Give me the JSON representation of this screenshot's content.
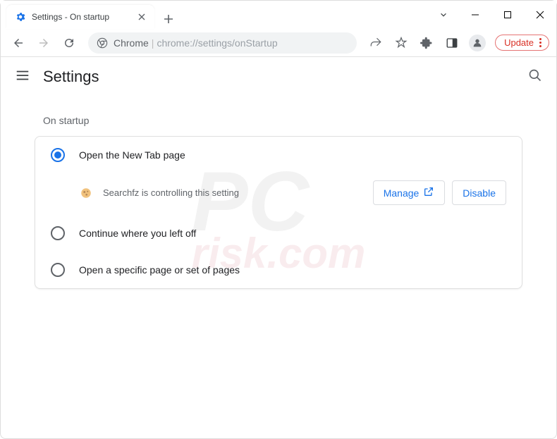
{
  "window": {
    "tab_title": "Settings - On startup"
  },
  "toolbar": {
    "omnibox_origin": "Chrome",
    "omnibox_path": "chrome://settings/onStartup",
    "update_label": "Update"
  },
  "settings": {
    "title": "Settings",
    "section_label": "On startup",
    "options": [
      {
        "label": "Open the New Tab page",
        "selected": true
      },
      {
        "label": "Continue where you left off",
        "selected": false
      },
      {
        "label": "Open a specific page or set of pages",
        "selected": false
      }
    ],
    "extension_notice": "Searchfz is controlling this setting",
    "manage_label": "Manage",
    "disable_label": "Disable"
  },
  "watermark": {
    "line1": "PC",
    "line2": "risk.com"
  }
}
